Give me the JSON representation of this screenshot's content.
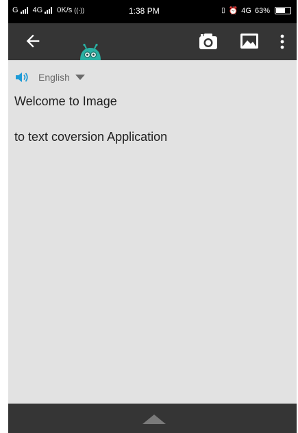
{
  "status_bar": {
    "carrier_left": "G",
    "network_type": "4G",
    "data_speed": "0K/s",
    "time": "1:38 PM",
    "network_right": "4G",
    "battery_percent": "63%",
    "battery_level": 0.63
  },
  "app_bar": {
    "back_icon": "arrow-left-icon",
    "mascot_icon": "robot-mascot-icon",
    "camera_icon": "camera-icon",
    "gallery_icon": "image-icon",
    "menu_icon": "more-vert-icon"
  },
  "language": {
    "selected": "English",
    "speaker_icon": "speaker-icon",
    "caret_icon": "caret-down-icon"
  },
  "content": {
    "line1": "Welcome to Image",
    "line2": "to text coversion Application"
  },
  "bottom_bar": {
    "expand_icon": "caret-up-icon"
  },
  "colors": {
    "app_bar": "#353535",
    "background": "#e2e2e2",
    "accent": "#1e9bd7",
    "mascot": "#2ab0a3"
  }
}
